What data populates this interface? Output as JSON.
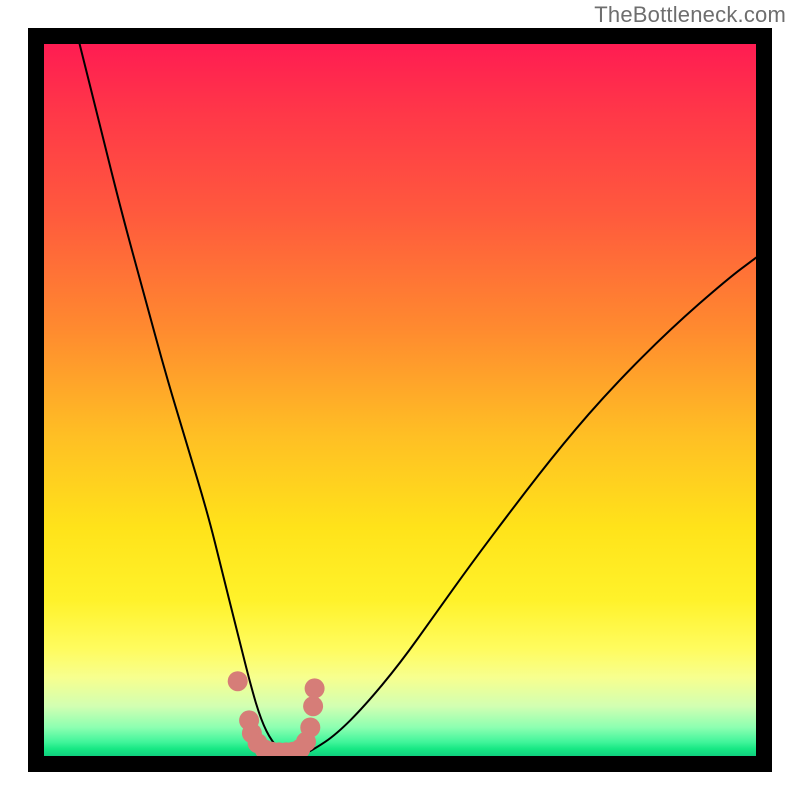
{
  "watermark": "TheBottleneck.com",
  "chart_data": {
    "type": "line",
    "title": "",
    "xlabel": "",
    "ylabel": "",
    "xlim": [
      0,
      100
    ],
    "ylim": [
      0,
      100
    ],
    "background_gradient_stops": [
      {
        "pos": 0,
        "color": "#ff1c52"
      },
      {
        "pos": 10,
        "color": "#ff3848"
      },
      {
        "pos": 24,
        "color": "#ff5a3d"
      },
      {
        "pos": 40,
        "color": "#ff8a2f"
      },
      {
        "pos": 55,
        "color": "#ffbf24"
      },
      {
        "pos": 68,
        "color": "#ffe31a"
      },
      {
        "pos": 78,
        "color": "#fff22a"
      },
      {
        "pos": 85,
        "color": "#fffc5f"
      },
      {
        "pos": 89,
        "color": "#f7ff8f"
      },
      {
        "pos": 93,
        "color": "#d2ffb2"
      },
      {
        "pos": 96,
        "color": "#8cffb1"
      },
      {
        "pos": 98,
        "color": "#42f59b"
      },
      {
        "pos": 99,
        "color": "#17e884"
      },
      {
        "pos": 100,
        "color": "#0fce7e"
      }
    ],
    "series": [
      {
        "name": "bottleneck-curve",
        "x": [
          5,
          8,
          11,
          14,
          17,
          20,
          23,
          25,
          27,
          29,
          30.5,
          32,
          34,
          36,
          38,
          41,
          45,
          50,
          55,
          60,
          66,
          73,
          80,
          88,
          96,
          100
        ],
        "y": [
          100,
          88,
          76,
          65,
          54,
          44,
          34,
          26,
          18,
          10,
          5,
          2,
          0,
          0,
          1,
          3,
          7,
          13,
          20,
          27,
          35,
          44,
          52,
          60,
          67,
          70
        ]
      },
      {
        "name": "marker-cluster",
        "type": "scatter",
        "color": "#d67d78",
        "x": [
          27.2,
          28.8,
          29.2,
          30.0,
          31.0,
          32.0,
          33.0,
          34.0,
          35.0,
          36.0,
          36.8,
          37.4,
          37.8,
          38.0
        ],
        "y": [
          10.5,
          5.0,
          3.2,
          1.8,
          0.9,
          0.6,
          0.5,
          0.5,
          0.6,
          1.0,
          2.0,
          4.0,
          7.0,
          9.5
        ]
      }
    ]
  }
}
